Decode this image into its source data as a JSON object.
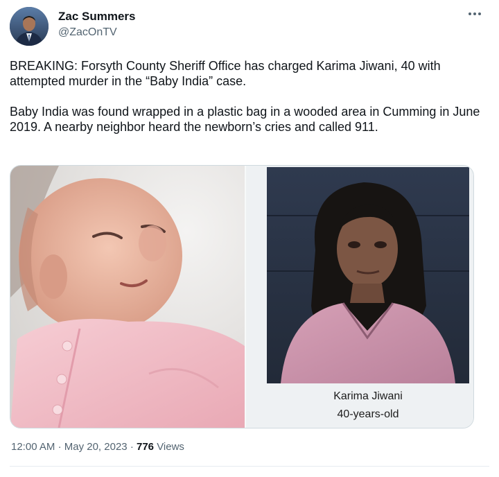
{
  "author": {
    "name": "Zac Summers",
    "handle": "@ZacOnTV",
    "avatar_icon": "profile-photo"
  },
  "more_icon": "more-horizontal-icon",
  "tweet": {
    "paragraph1": "BREAKING: Forsyth County Sheriff Office has charged Karima Jiwani, 40 with attempted murder in the “Baby India” case.",
    "paragraph2": "Baby India was found wrapped in a plastic bag in a wooded area in Cumming in June 2019. A nearby neighbor heard the newborn’s cries and called 911."
  },
  "media": {
    "caption_line1": "Karima Jiwani",
    "caption_line2": "40-years-old"
  },
  "meta": {
    "time": "12:00 AM",
    "separator": "·",
    "date": "May 20, 2023",
    "views_count": "776",
    "views_label": "Views"
  },
  "colors": {
    "text_primary": "#0f1419",
    "text_secondary": "#536471",
    "border": "#cfd9de"
  }
}
